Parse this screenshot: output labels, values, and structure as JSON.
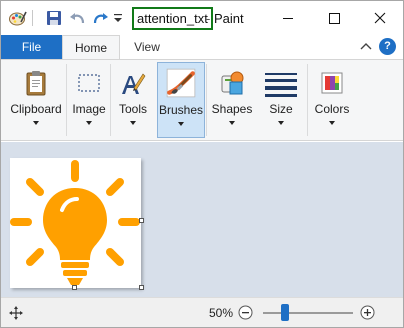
{
  "titlebar": {
    "document_name": "attention_txt",
    "separator": "-",
    "app_name": "Paint"
  },
  "tabs": [
    {
      "label": "File"
    },
    {
      "label": "Home"
    },
    {
      "label": "View"
    }
  ],
  "help": {
    "glyph": "?"
  },
  "ribbon": {
    "groups": [
      {
        "label": "Clipboard",
        "icon": "clipboard-icon"
      },
      {
        "label": "Image",
        "icon": "image-select-icon"
      },
      {
        "label": "Tools",
        "icon": "tools-icon"
      },
      {
        "label": "Brushes",
        "icon": "brush-icon",
        "active": true
      },
      {
        "label": "Shapes",
        "icon": "shapes-icon"
      },
      {
        "label": "Size",
        "icon": "size-lines-icon"
      },
      {
        "label": "Colors",
        "icon": "colors-icon"
      }
    ]
  },
  "canvas": {
    "image": "lightbulb-icon",
    "image_color": "#FFA000"
  },
  "statusbar": {
    "zoom_level": "50%",
    "zoom_fraction": 0.2
  },
  "colors": {
    "accent": "#1E6FC5",
    "title_highlight_border": "#117A18",
    "workspace": "#D7DFEA"
  }
}
